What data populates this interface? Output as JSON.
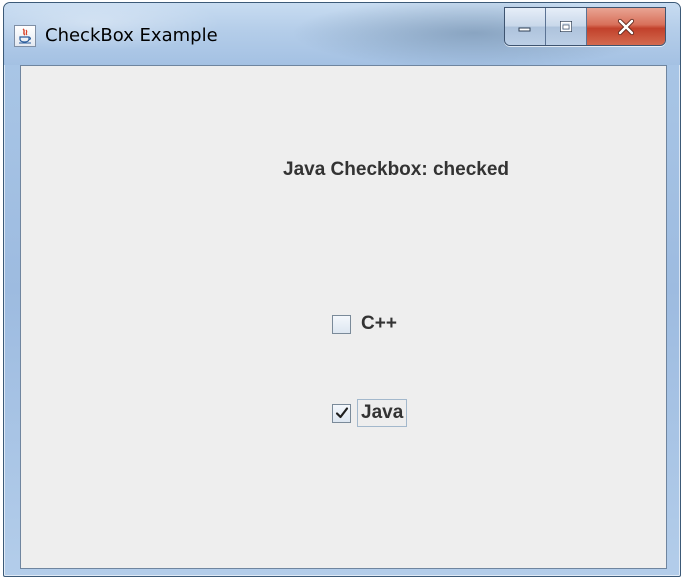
{
  "window": {
    "title": "CheckBox Example",
    "controls": [
      "minimize-icon",
      "maximize-icon",
      "close-icon"
    ]
  },
  "status": {
    "text": "Java Checkbox: checked"
  },
  "checkboxes": [
    {
      "label": "C++",
      "checked": false,
      "focused": false
    },
    {
      "label": "Java",
      "checked": true,
      "focused": true
    }
  ],
  "colors": {
    "content_bg": "#eeeeee",
    "text": "#333333",
    "close_button": "#c2412b"
  }
}
